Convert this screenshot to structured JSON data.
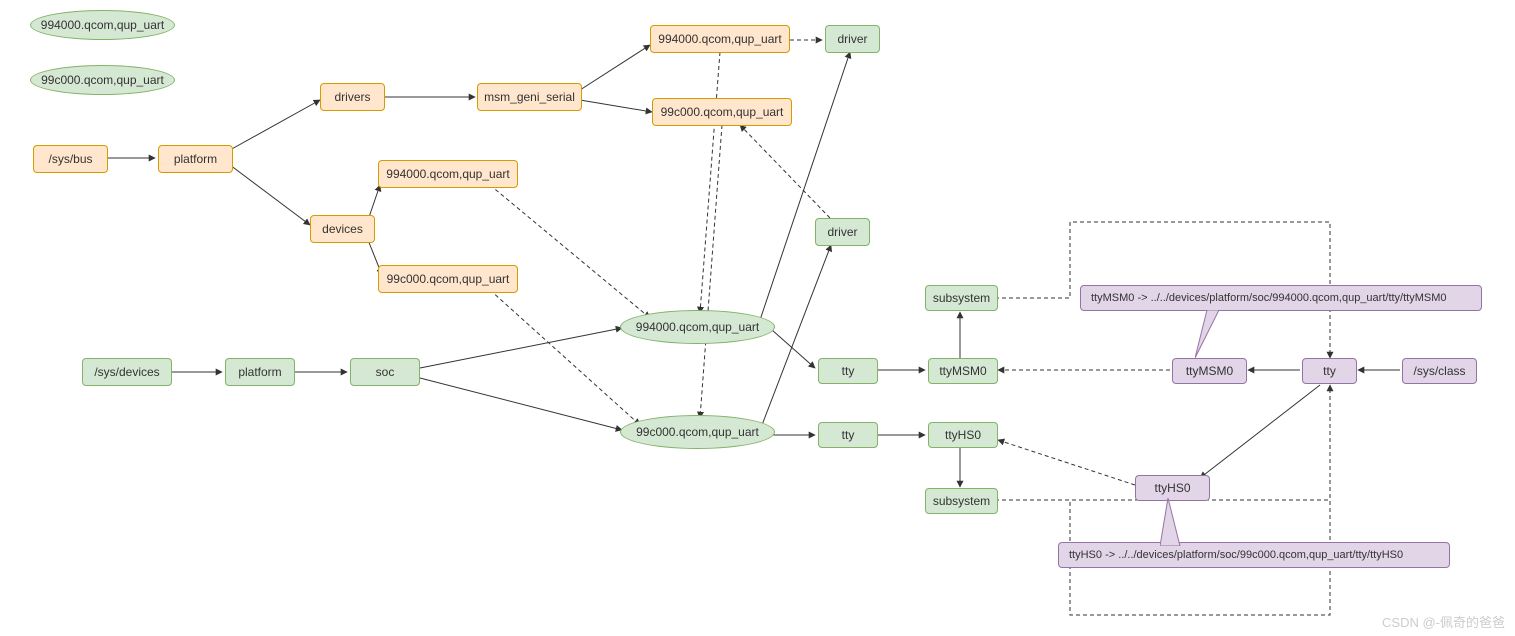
{
  "nodes": {
    "legend1": "994000.qcom,qup_uart",
    "legend2": "99c000.qcom,qup_uart",
    "sysbus": "/sys/bus",
    "platform1": "platform",
    "drivers": "drivers",
    "devices": "devices",
    "msm_geni": "msm_geni_serial",
    "uart994_top": "994000.qcom,qup_uart",
    "uart99c_top": "99c000.qcom,qup_uart",
    "uart994_dev": "994000.qcom,qup_uart",
    "uart99c_dev": "99c000.qcom,qup_uart",
    "driver1": "driver",
    "driver2": "driver",
    "sysdevices": "/sys/devices",
    "platform2": "platform",
    "soc": "soc",
    "ellipse994": "994000.qcom,qup_uart",
    "ellipse99c": "99c000.qcom,qup_uart",
    "tty1": "tty",
    "tty2": "tty",
    "ttyMSM0": "ttyMSM0",
    "ttyHS0": "ttyHS0",
    "subsystem1": "subsystem",
    "subsystem2": "subsystem",
    "ttyMSM0_p": "ttyMSM0",
    "ttyHS0_p": "ttyHS0",
    "tty_p": "tty",
    "sysclass": "/sys/class"
  },
  "callouts": {
    "c1": "ttyMSM0 -> ../../devices/platform/soc/994000.qcom,qup_uart/tty/ttyMSM0",
    "c2": "ttyHS0 -> ../../devices/platform/soc/99c000.qcom,qup_uart/tty/ttyHS0"
  },
  "watermark": "CSDN @-佩奇的爸爸"
}
